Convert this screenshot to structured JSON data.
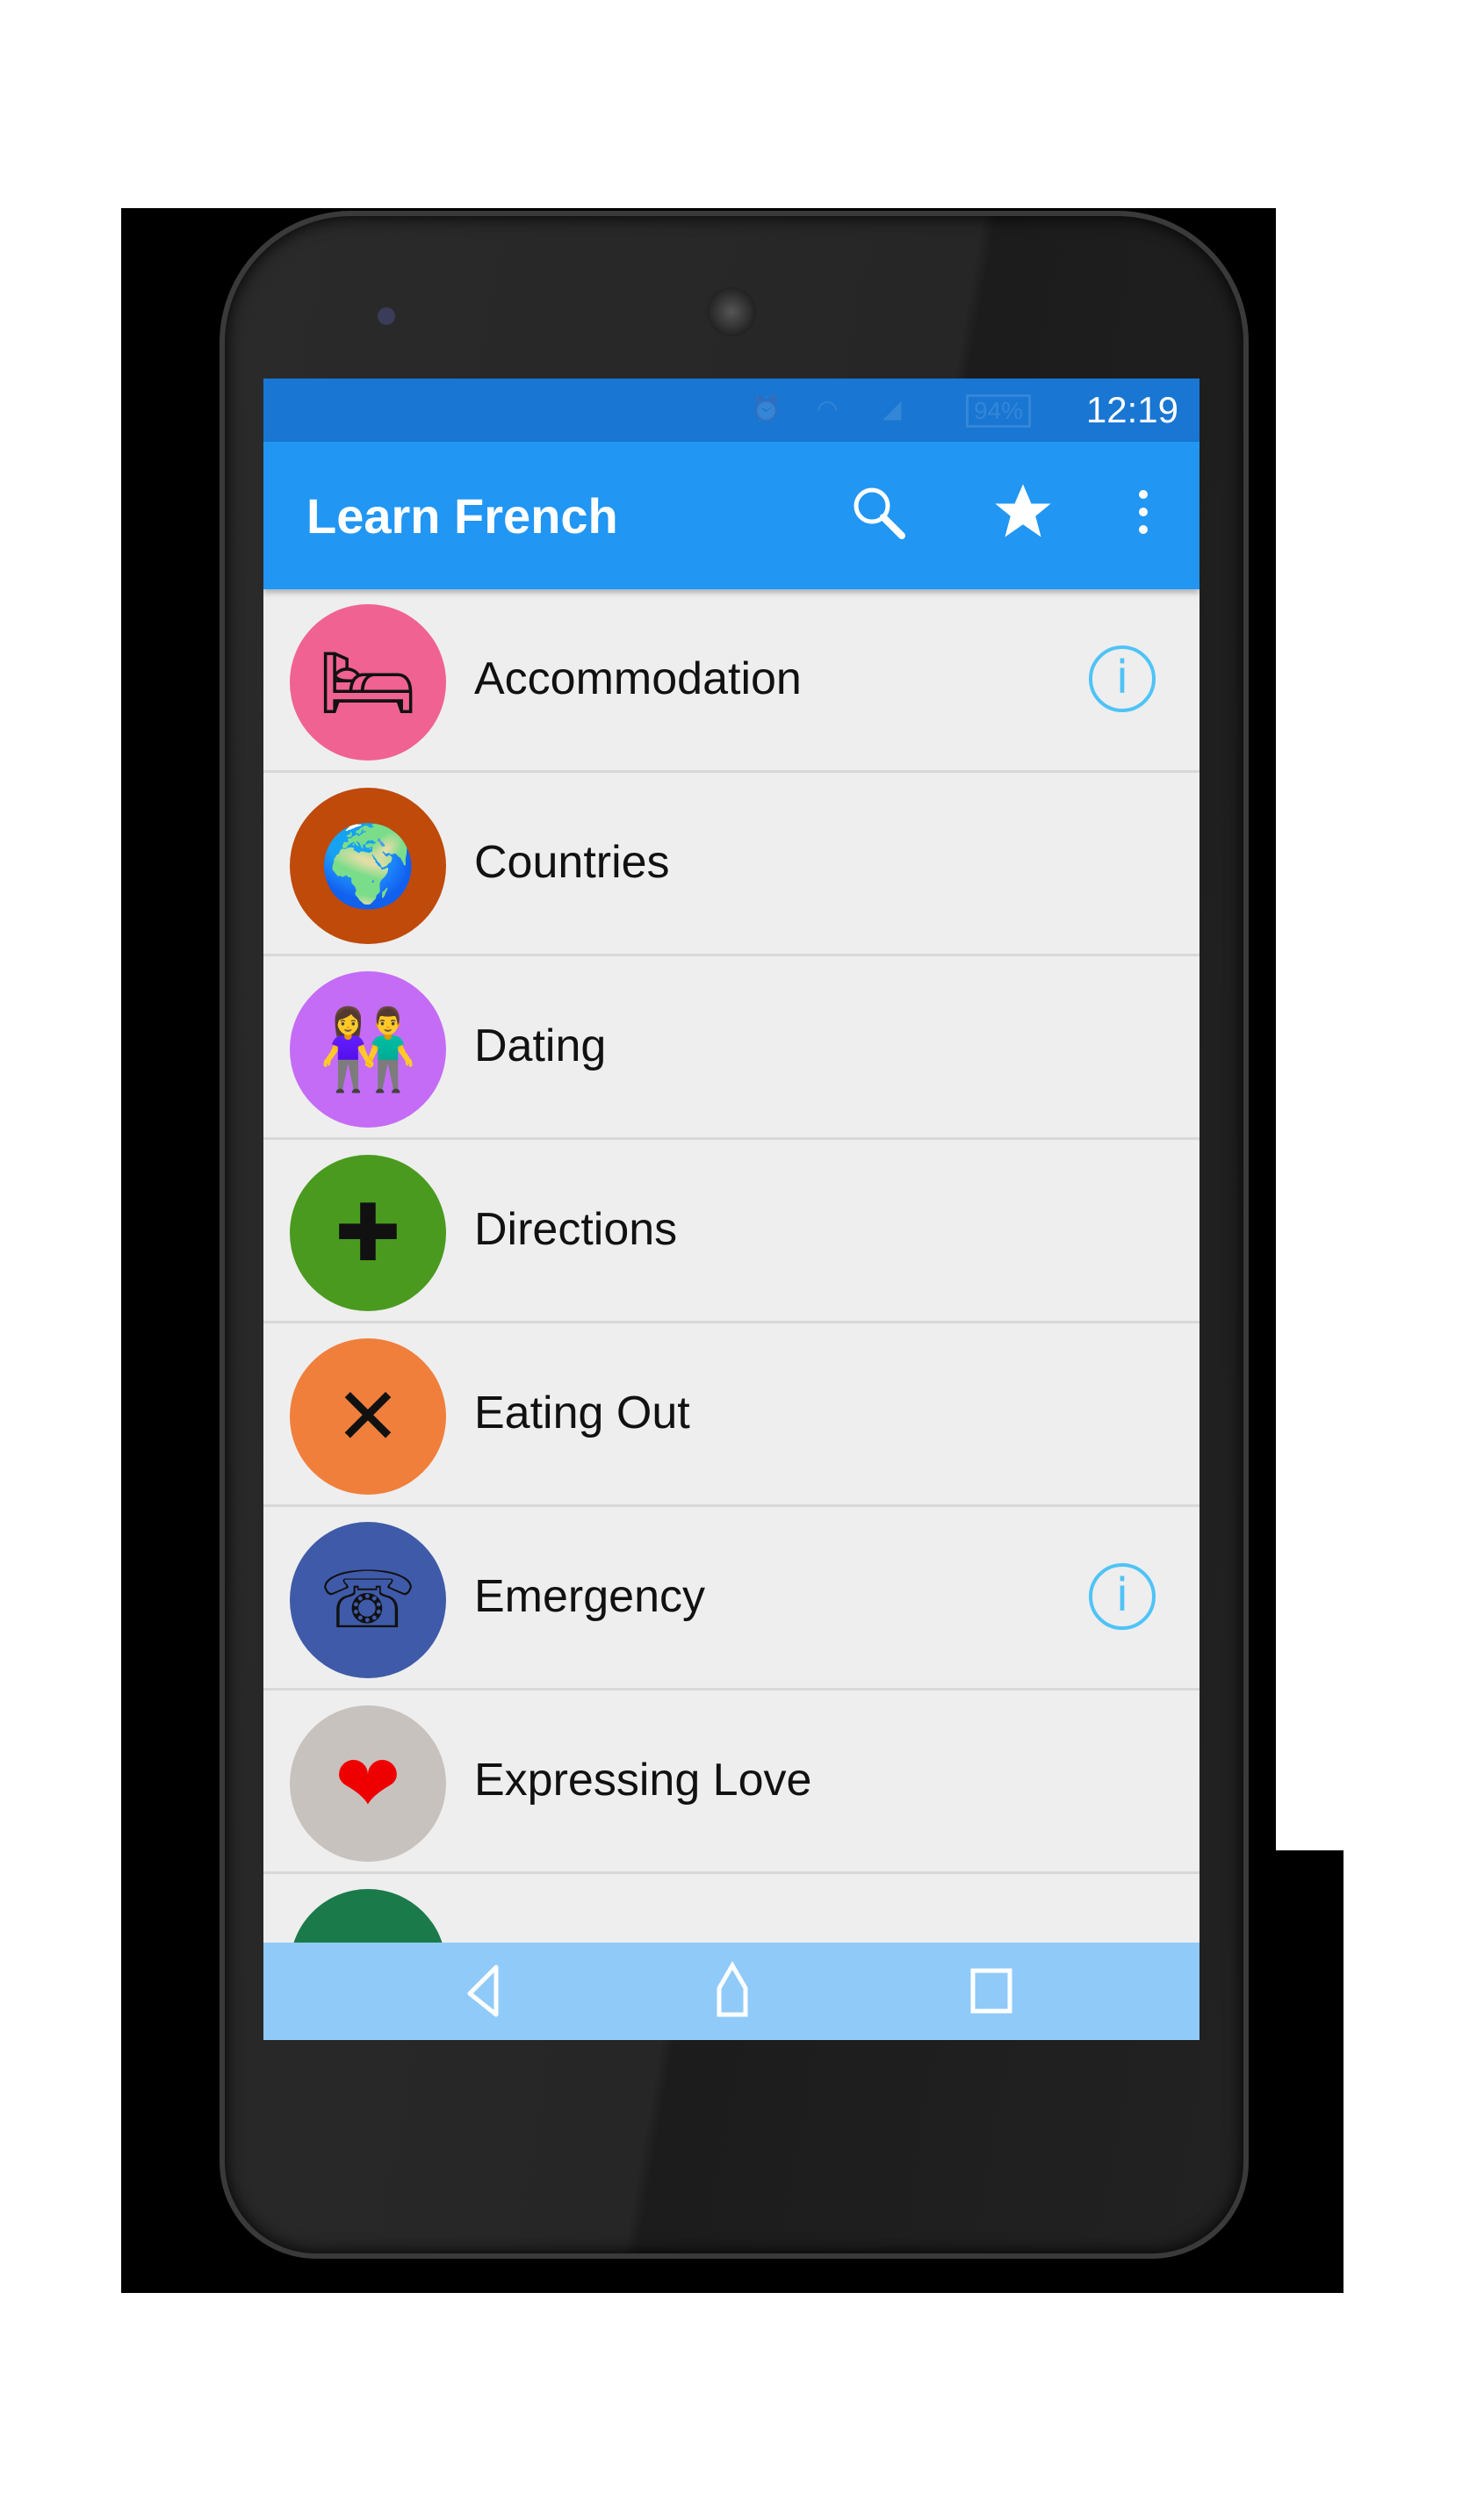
{
  "status_bar": {
    "time": "12:19",
    "battery": "94%",
    "icons": [
      "alarm-icon",
      "wifi-icon",
      "signal-icon",
      "battery-icon"
    ]
  },
  "app_bar": {
    "title": "Learn French",
    "actions": [
      "search-icon",
      "star-icon",
      "more-vert-icon"
    ]
  },
  "categories": [
    {
      "label": "Accommodation",
      "color": "#f06292",
      "icon": "bed-icon",
      "info": true
    },
    {
      "label": "Countries",
      "color": "#bf4a0a",
      "icon": "globe-icon",
      "info": false
    },
    {
      "label": "Dating",
      "color": "#c46cf5",
      "icon": "couple-icon",
      "info": false
    },
    {
      "label": "Directions",
      "color": "#4a9a1f",
      "icon": "signpost-icon",
      "info": false
    },
    {
      "label": "Eating Out",
      "color": "#f07f3c",
      "icon": "cutlery-icon",
      "info": false
    },
    {
      "label": "Emergency",
      "color": "#3f5aa8",
      "icon": "phone-medical-icon",
      "info": true
    },
    {
      "label": "Expressing Love",
      "color": "#c8c2be",
      "icon": "heart-icon",
      "info": false
    },
    {
      "label": "",
      "color": "#1b7a4a",
      "icon": "partial-icon",
      "info": false
    }
  ],
  "nav_bar": [
    "back-icon",
    "home-icon",
    "recents-icon"
  ]
}
